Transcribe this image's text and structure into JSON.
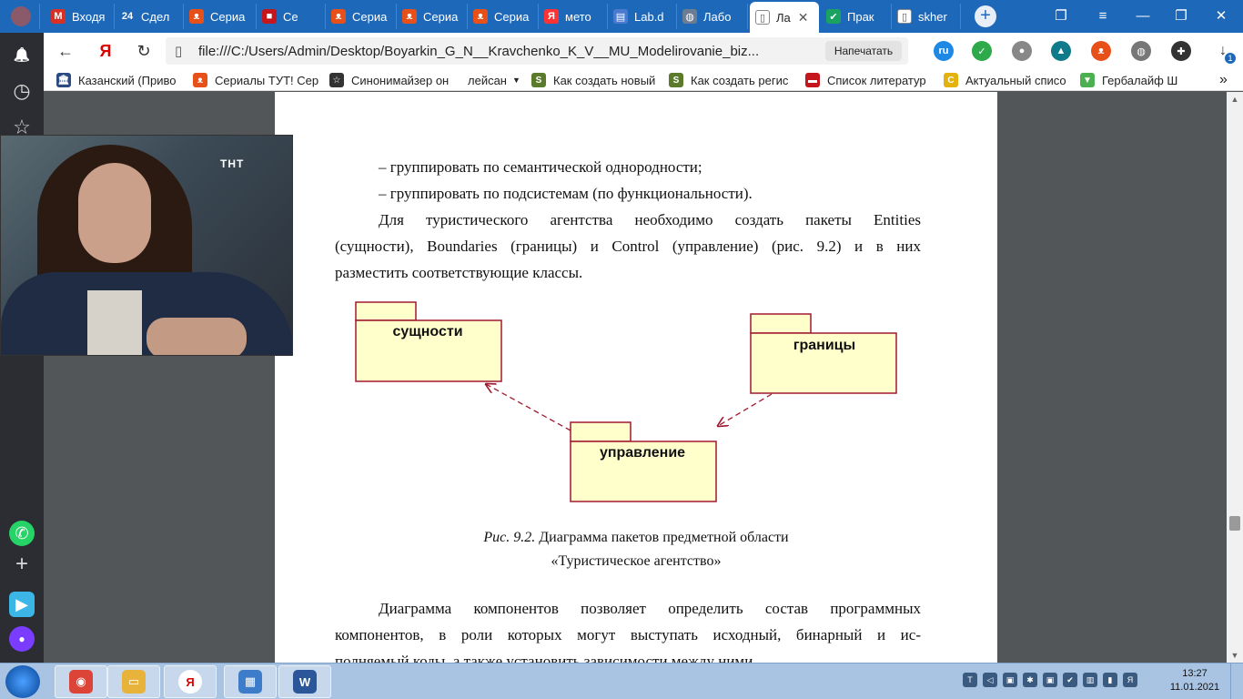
{
  "tabs": [
    {
      "label": "Входя",
      "icon": "mail-icon",
      "color": "#d93025",
      "glyph": "M"
    },
    {
      "label": "Сдел",
      "icon": "news-icon",
      "color": "#1e68b9",
      "glyph": "24"
    },
    {
      "label": "Сериа",
      "icon": "fox-icon",
      "color": "#e8501a",
      "glyph": "ᴥ"
    },
    {
      "label": "Се",
      "icon": "book-icon",
      "color": "#c4161c",
      "glyph": "■"
    },
    {
      "label": "Сериа",
      "icon": "fox-icon",
      "color": "#e8501a",
      "glyph": "ᴥ"
    },
    {
      "label": "Сериа",
      "icon": "fox-icon",
      "color": "#e8501a",
      "glyph": "ᴥ"
    },
    {
      "label": "Сериа",
      "icon": "fox-icon",
      "color": "#e8501a",
      "glyph": "ᴥ"
    },
    {
      "label": "мето",
      "icon": "yandex-icon",
      "color": "#ff3333",
      "glyph": "Я"
    },
    {
      "label": "Lab.d",
      "icon": "doc-icon",
      "color": "#4a7bd0",
      "glyph": "▤"
    },
    {
      "label": "Лабо",
      "icon": "globe-icon",
      "color": "#6b7c93",
      "glyph": "◍"
    },
    {
      "label": "Ла",
      "icon": "pdf-icon",
      "color": "#ffffff",
      "glyph": "▯"
    },
    {
      "label": "Прак",
      "icon": "check-icon",
      "color": "#1aa260",
      "glyph": "✔"
    },
    {
      "label": "skher",
      "icon": "file-icon",
      "color": "#ffffff",
      "glyph": "▯"
    }
  ],
  "address": {
    "url": "file:///C:/Users/Admin/Desktop/Boyarkin_G_N__Kravchenko_K_V__MU_Modelirovanie_biz...",
    "print_label": "Напечатать",
    "back_glyph": "←",
    "yandex_glyph": "Я",
    "reload_glyph": "↻",
    "file_glyph": "▯"
  },
  "extensions": [
    {
      "name": "ext-ru-icon",
      "color": "#1e88e5",
      "glyph": "ru"
    },
    {
      "name": "shield-icon",
      "color": "#2eaa4a",
      "glyph": "✓"
    },
    {
      "name": "search-ext-icon",
      "color": "#888888",
      "glyph": "●"
    },
    {
      "name": "vpn-icon",
      "color": "#0f7a8a",
      "glyph": "▲"
    },
    {
      "name": "fox-ext-icon",
      "color": "#e8501a",
      "glyph": "ᴥ"
    },
    {
      "name": "globe-ext-icon",
      "color": "#777777",
      "glyph": "◍"
    },
    {
      "name": "puzzle-icon",
      "color": "#333333",
      "glyph": "✚"
    }
  ],
  "download_badge": "1",
  "window_controls": {
    "tabs_glyph": "❐",
    "menu_glyph": "≡",
    "minimize_glyph": "—",
    "restore_glyph": "❐",
    "close_glyph": "✕",
    "download_glyph": "↓",
    "new_tab_glyph": "+"
  },
  "bookmarks": [
    {
      "label": "Казанский (Приво",
      "color": "#2a4a80",
      "glyph": "🏛"
    },
    {
      "label": "Сериалы ТУТ! Сер",
      "color": "#e8501a",
      "glyph": "ᴥ"
    },
    {
      "label": "Синонимайзер он",
      "color": "#333333",
      "glyph": "☆"
    },
    {
      "label": "лейсан",
      "color": "",
      "glyph": ""
    },
    {
      "label": "Как создать новый",
      "color": "#5c7a2b",
      "glyph": "S"
    },
    {
      "label": "Как создать регис",
      "color": "#5c7a2b",
      "glyph": "S"
    },
    {
      "label": "Список литератур",
      "color": "#c4161c",
      "glyph": "▬"
    },
    {
      "label": "Актуальный списо",
      "color": "#e3b20c",
      "glyph": "C"
    },
    {
      "label": "Гербалайф Ш",
      "color": "#4caf50",
      "glyph": "▼"
    }
  ],
  "bookmarks_more_glyph": "»",
  "bookmarks_dropdown_glyph": "▼",
  "sidebar_glyphs": {
    "bell": "🔔",
    "clock": "◷",
    "star": "☆",
    "whatsapp": "✆",
    "add": "+",
    "messenger": "▶",
    "alice": "●"
  },
  "document": {
    "bullets": [
      "–  группировать по семантической однородности;",
      "–  группировать по подсистемам (по функциональности)."
    ],
    "paragraph1": [
      "Для туристического агентства необходимо создать пакеты Entities",
      "(сущности), Boundaries (границы) и Control (управление) (рис. 9.2) и в них",
      "разместить соответствующие классы."
    ],
    "diagram": {
      "packages": [
        "сущности",
        "границы",
        "управление"
      ],
      "border_color": "#a01830",
      "fill_color": "#ffffcc"
    },
    "caption_prefix": "Рис. 9.2.",
    "caption_line1": " Диаграмма пакетов предметной области",
    "caption_line2": "«Туристическое агентство»",
    "paragraph2": [
      "Диаграмма компонентов позволяет определить состав программных",
      "компонентов, в роли которых могут выступать исходный, бинарный и ис-",
      "полняемый коды, а также установить зависимости между ними."
    ]
  },
  "video": {
    "channel_logo": "ТНТ"
  },
  "taskbar": {
    "apps": [
      {
        "name": "chrome",
        "color": "#db4437",
        "glyph": "◉"
      },
      {
        "name": "explorer",
        "color": "#e8b33a",
        "glyph": "▭"
      },
      {
        "name": "yandex",
        "color": "#ffffff",
        "glyph": "Я"
      },
      {
        "name": "control-panel",
        "color": "#3d7cc9",
        "glyph": "▦"
      },
      {
        "name": "word",
        "color": "#2b579a",
        "glyph": "W"
      }
    ],
    "clock_time": "13:27",
    "clock_date": "11.01.2021",
    "tray_glyphs": [
      "T",
      "◁",
      "▣",
      "✱",
      "▣",
      "✔",
      "▥",
      "▮",
      "Я"
    ]
  }
}
